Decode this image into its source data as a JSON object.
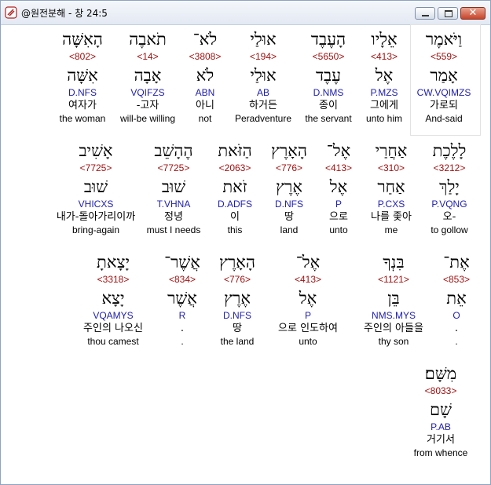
{
  "window": {
    "title": "@원전분해 - 창 24:5"
  },
  "rows": [
    [
      {
        "heb": "וַיֹּאמֶר",
        "num": "<559>",
        "lex": "אָמַר",
        "parse": "CW.VQIMZS",
        "kor": "가로되",
        "eng": "And-said"
      },
      {
        "heb": "אֵלָיו",
        "num": "<413>",
        "lex": "אֶל",
        "parse": "P.MZS",
        "kor": "그에게",
        "eng": "unto him"
      },
      {
        "heb": "הָעֶבֶד",
        "num": "<5650>",
        "lex": "עֶבֶד",
        "parse": "D.NMS",
        "kor": "종이",
        "eng": "the servant"
      },
      {
        "heb": "אוּלַי",
        "num": "<194>",
        "lex": "אוּלַי",
        "parse": "AB",
        "kor": "하거든",
        "eng": "Peradventure"
      },
      {
        "heb": "לֹא־",
        "num": "<3808>",
        "lex": "לֹא",
        "parse": "ABN",
        "kor": "아니",
        "eng": "not"
      },
      {
        "heb": "תֹאבֶה",
        "num": "<14>",
        "lex": "אָבָה",
        "parse": "VQIFZS",
        "kor": "-고자",
        "eng": "will-be willing"
      },
      {
        "heb": "הָאִשָּׁה",
        "num": "<802>",
        "lex": "אִשָּׁה",
        "parse": "D.NFS",
        "kor": "여자가",
        "eng": "the woman"
      }
    ],
    [
      {
        "heb": "לָלֶכֶת",
        "num": "<3212>",
        "lex": "יָלַךְ",
        "parse": "P.VQNG",
        "kor": "오-",
        "eng": "to gollow"
      },
      {
        "heb": "אַחֲרַי",
        "num": "<310>",
        "lex": "אַחַר",
        "parse": "P.CXS",
        "kor": "나를 좇아",
        "eng": "me"
      },
      {
        "heb": "אֶל־",
        "num": "<413>",
        "lex": "אֶל",
        "parse": "P",
        "kor": "으로",
        "eng": "unto"
      },
      {
        "heb": "הָאָרֶץ",
        "num": "<776>",
        "lex": "אֶרֶץ",
        "parse": "D.NFS",
        "kor": "땅",
        "eng": "land"
      },
      {
        "heb": "הַזֹּאת",
        "num": "<2063>",
        "lex": "זֹאת",
        "parse": "D.ADFS",
        "kor": "이",
        "eng": "this"
      },
      {
        "heb": "הֶהָשֵׁב",
        "num": "<7725>",
        "lex": "שׁוּב",
        "parse": "T.VHNA",
        "kor": "정녕",
        "eng": "must I needs"
      },
      {
        "heb": "אָשִׁיב",
        "num": "<7725>",
        "lex": "שׁוּב",
        "parse": "VHICXS",
        "kor": "내가-돌아가리이까",
        "eng": "bring-again"
      }
    ],
    [
      {
        "heb": "אֶת־",
        "num": "<853>",
        "lex": "אֵת",
        "parse": "O",
        "kor": ".",
        "eng": "."
      },
      {
        "heb": "בִּנְךָ",
        "num": "<1121>",
        "lex": "בֵּן",
        "parse": "NMS.MYS",
        "kor": "주인의 아들을",
        "eng": "thy son"
      },
      {
        "heb": "אֶל־",
        "num": "<413>",
        "lex": "אֶל",
        "parse": "P",
        "kor": "으로 인도하여",
        "eng": "unto"
      },
      {
        "heb": "הָאָרֶץ",
        "num": "<776>",
        "lex": "אֶרֶץ",
        "parse": "D.NFS",
        "kor": "땅",
        "eng": "the land"
      },
      {
        "heb": "אֲשֶׁר־",
        "num": "<834>",
        "lex": "אֲשֶׁר",
        "parse": "R",
        "kor": ".",
        "eng": "."
      },
      {
        "heb": "יָצָאתָ",
        "num": "<3318>",
        "lex": "יָצָא",
        "parse": "VQAMYS",
        "kor": "주인의 나오신",
        "eng": "thou camest"
      }
    ],
    [
      {
        "heb": "מִשָּׁם׃",
        "num": "<8033>",
        "lex": "שָׁם",
        "parse": "P.AB",
        "kor": "거기서",
        "eng": "from whence"
      }
    ]
  ]
}
